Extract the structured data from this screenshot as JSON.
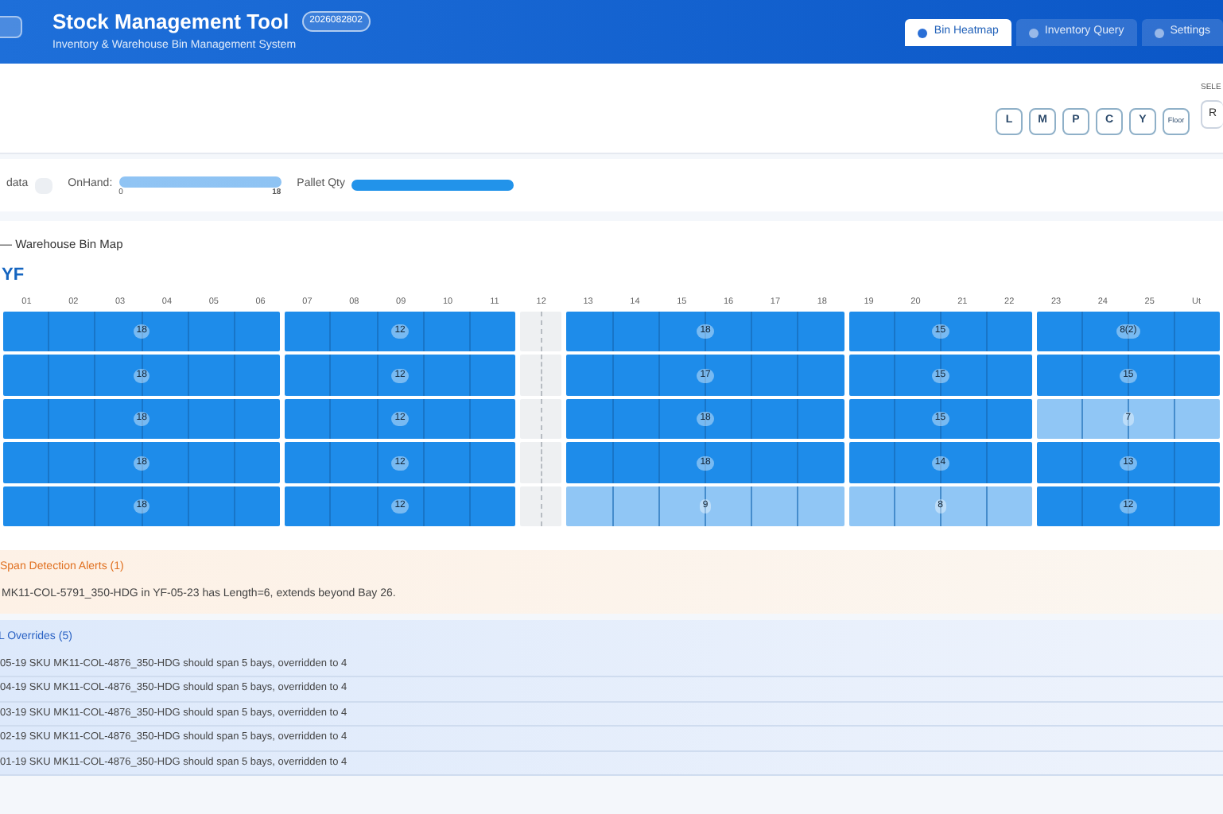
{
  "header": {
    "title": "Stock Management Tool",
    "badge": "2026082802",
    "subtitle": "Inventory & Warehouse Bin Management System",
    "tabs": [
      {
        "label": "Bin Heatmap",
        "selected": true
      },
      {
        "label": "Inventory Query",
        "selected": false
      },
      {
        "label": "Settings",
        "selected": false
      }
    ]
  },
  "toolbar": {
    "filters": [
      "L",
      "M",
      "P",
      "C",
      "Y",
      "Floor"
    ],
    "select_label": "SELE",
    "select_value": "R"
  },
  "legend": {
    "no_data": "data",
    "onhand_label": "OnHand:",
    "onhand_min": "0",
    "onhand_max": "18",
    "pallet_label": "Pallet Qty"
  },
  "map": {
    "title": "— Warehouse Bin Map",
    "zone": "YF",
    "bays": [
      "01",
      "02",
      "03",
      "04",
      "05",
      "06",
      "07",
      "08",
      "09",
      "10",
      "11",
      "12",
      "13",
      "14",
      "15",
      "16",
      "17",
      "18",
      "19",
      "20",
      "21",
      "22",
      "23",
      "24",
      "25",
      "Ut"
    ],
    "rows": [
      [
        {
          "kind": "high",
          "value": "18"
        },
        {
          "kind": "high",
          "value": "12"
        },
        {
          "kind": "empty"
        },
        {
          "kind": "high",
          "value": "18"
        },
        {
          "kind": "high",
          "value": "15"
        },
        {
          "kind": "high",
          "value": "8(2)"
        }
      ],
      [
        {
          "kind": "high",
          "value": "18"
        },
        {
          "kind": "high",
          "value": "12"
        },
        {
          "kind": "empty"
        },
        {
          "kind": "high",
          "value": "17"
        },
        {
          "kind": "high",
          "value": "15"
        },
        {
          "kind": "high",
          "value": "15"
        }
      ],
      [
        {
          "kind": "high",
          "value": "18"
        },
        {
          "kind": "high",
          "value": "12"
        },
        {
          "kind": "empty"
        },
        {
          "kind": "high",
          "value": "18"
        },
        {
          "kind": "high",
          "value": "15"
        },
        {
          "kind": "low",
          "value": "7"
        }
      ],
      [
        {
          "kind": "high",
          "value": "18"
        },
        {
          "kind": "high",
          "value": "12"
        },
        {
          "kind": "empty"
        },
        {
          "kind": "high",
          "value": "18"
        },
        {
          "kind": "high",
          "value": "14"
        },
        {
          "kind": "high",
          "value": "13"
        }
      ],
      [
        {
          "kind": "high",
          "value": "18"
        },
        {
          "kind": "high",
          "value": "12"
        },
        {
          "kind": "empty"
        },
        {
          "kind": "low",
          "value": "9"
        },
        {
          "kind": "low",
          "value": "8"
        },
        {
          "kind": "high",
          "value": "12"
        }
      ]
    ]
  },
  "alerts": {
    "title": "Span Detection Alerts (1)",
    "items": [
      "MK11-COL-5791_350-HDG in YF-05-23 has Length=6, extends beyond Bay 26."
    ]
  },
  "overrides": {
    "title": "L Overrides (5)",
    "items": [
      "05-19 SKU MK11-COL-4876_350-HDG should span 5 bays, overridden to 4",
      "04-19 SKU MK11-COL-4876_350-HDG should span 5 bays, overridden to 4",
      "03-19 SKU MK11-COL-4876_350-HDG should span 5 bays, overridden to 4",
      "02-19 SKU MK11-COL-4876_350-HDG should span 5 bays, overridden to 4",
      "01-19 SKU MK11-COL-4876_350-HDG should span 5 bays, overridden to 4"
    ]
  }
}
